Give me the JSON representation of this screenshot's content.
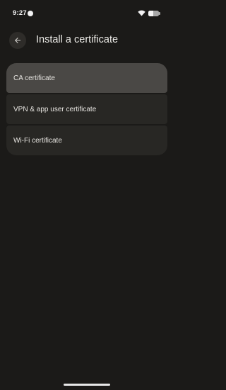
{
  "status_bar": {
    "time": "9:27",
    "battery_level": 0.45
  },
  "header": {
    "back_icon": "arrow-left-icon",
    "title": "Install a certificate"
  },
  "options": [
    {
      "label": "CA certificate",
      "selected": true
    },
    {
      "label": "VPN & app user certificate",
      "selected": false
    },
    {
      "label": "Wi-Fi certificate",
      "selected": false
    }
  ],
  "colors": {
    "background": "#1b1a18",
    "option_background": "#282724",
    "option_selected_background": "#4a4845",
    "back_button_background": "#2e2c29"
  }
}
